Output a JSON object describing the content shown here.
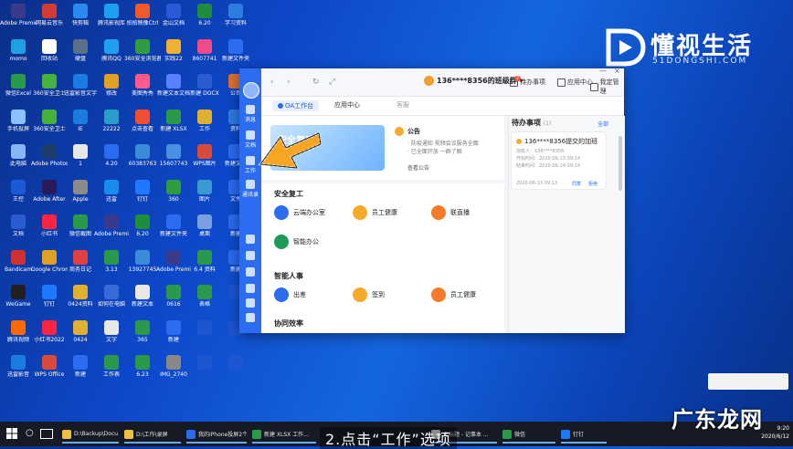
{
  "desktop": {
    "icons": [
      {
        "label": "Adobe Premie",
        "color": "#3a3a8c"
      },
      {
        "label": "网易云音乐",
        "color": "#d43c33"
      },
      {
        "label": "快剪辑",
        "color": "#2b8af0"
      },
      {
        "label": "腾讯影视库",
        "color": "#1aa0f0"
      },
      {
        "label": "拍拍映像Ctrl",
        "color": "#f05a28"
      },
      {
        "label": "金山文档",
        "color": "#2a5bd7"
      },
      {
        "label": "6.20",
        "color": "#1f8d3c"
      },
      {
        "label": "学习资料",
        "color": "#2d7de0"
      },
      {
        "label": "momo",
        "color": "#20a0e0"
      },
      {
        "label": "回收站",
        "color": "#ffffff"
      },
      {
        "label": "硬盘",
        "color": "#5b6f8a"
      },
      {
        "label": "腾讯QQ",
        "color": "#1ea0ef"
      },
      {
        "label": "360安全浏览器",
        "color": "#2e9c3f"
      },
      {
        "label": "实践22",
        "color": "#f0b030"
      },
      {
        "label": "8607741",
        "color": "#f04a8a"
      },
      {
        "label": "新建文件夹",
        "color": "#2b6cf0"
      },
      {
        "label": "微信Excel",
        "color": "#2a9a4a"
      },
      {
        "label": "360安全卫士",
        "color": "#47b33e"
      },
      {
        "label": "迅雷影音文字",
        "color": "#1a7ce0"
      },
      {
        "label": "修改",
        "color": "#e0a020"
      },
      {
        "label": "美图秀秀",
        "color": "#ff5a8a"
      },
      {
        "label": "新建文本文档",
        "color": "#5a7fff"
      },
      {
        "label": "新建 DOCX",
        "color": "#2b5bd0"
      },
      {
        "label": "公司",
        "color": "#e07030"
      },
      {
        "label": "手机投屏",
        "color": "#8ac0ff"
      },
      {
        "label": "360安全卫士",
        "color": "#47b33e"
      },
      {
        "label": "IE",
        "color": "#1a7ce0"
      },
      {
        "label": "22222",
        "color": "#2aa0c8"
      },
      {
        "label": "点击查看",
        "color": "#f05030"
      },
      {
        "label": "新建 XLSX",
        "color": "#2a9a4a"
      },
      {
        "label": "工作",
        "color": "#e0b030"
      },
      {
        "label": "资料",
        "color": "#2d7de0"
      },
      {
        "label": "此电脑",
        "color": "#8ab4f8"
      },
      {
        "label": "Adobe Photosh",
        "color": "#1c3d6a"
      },
      {
        "label": "1",
        "color": "#e8e8e8"
      },
      {
        "label": "4.20",
        "color": "#2b6cf0"
      },
      {
        "label": "60383763",
        "color": "#3a8bd8"
      },
      {
        "label": "15607743",
        "color": "#4a90e2"
      },
      {
        "label": "WPS图片",
        "color": "#d84a3a"
      },
      {
        "label": "新建文件",
        "color": "#2b6cf0"
      },
      {
        "label": "王控",
        "color": "#1a5ad6"
      },
      {
        "label": "Adobe After",
        "color": "#2a1a5a"
      },
      {
        "label": "Apple",
        "color": "#8a8a8a"
      },
      {
        "label": "迅雷",
        "color": "#1a8cf0"
      },
      {
        "label": "钉钉",
        "color": "#1f78ff"
      },
      {
        "label": "360",
        "color": "#2e9c3f"
      },
      {
        "label": "图片",
        "color": "#3a9ad0"
      },
      {
        "label": "文件",
        "color": "#2b6cf0"
      },
      {
        "label": "文档",
        "color": "#2b5bd0"
      },
      {
        "label": "小红书",
        "color": "#ff2442"
      },
      {
        "label": "微信截图",
        "color": "#2a9a4a"
      },
      {
        "label": "Adobe Premi",
        "color": "#3a3a8c"
      },
      {
        "label": "6.20",
        "color": "#1f8d3c"
      },
      {
        "label": "新建文件夹",
        "color": "#2b6cf0"
      },
      {
        "label": "桌面",
        "color": "#7aa0e0"
      },
      {
        "label": "新建",
        "color": "#2b6cf0"
      },
      {
        "label": "Bandicam",
        "color": "#d03030"
      },
      {
        "label": "Google Chrome",
        "color": "#e0a020"
      },
      {
        "label": "商务日记",
        "color": "#e04040"
      },
      {
        "label": "3.13",
        "color": "#2a9a4a"
      },
      {
        "label": "13927745",
        "color": "#3a8bd8"
      },
      {
        "label": "Adobe Premi",
        "color": "#3a3a8c"
      },
      {
        "label": "6.4 资料",
        "color": "#2a9a4a"
      },
      {
        "label": "新建",
        "color": "#2b6cf0"
      },
      {
        "label": "WeGame",
        "color": "#202020"
      },
      {
        "label": "钉钉",
        "color": "#1f78ff"
      },
      {
        "label": "0424资料",
        "color": "#e0b030"
      },
      {
        "label": "如何在电脑",
        "color": "#3a6ad8"
      },
      {
        "label": "新建文本",
        "color": "#e8e8e8"
      },
      {
        "label": "0616",
        "color": "#2a9a4a"
      },
      {
        "label": "表格",
        "color": "#2a9a4a"
      },
      {
        "label": "",
        "color": "#1e55d0"
      },
      {
        "label": "腾讯视频",
        "color": "#ff6a00"
      },
      {
        "label": "小红书2022",
        "color": "#ff2442"
      },
      {
        "label": "0424",
        "color": "#e0b030"
      },
      {
        "label": "文字",
        "color": "#e8e8e8"
      },
      {
        "label": "365",
        "color": "#2a9a4a"
      },
      {
        "label": "新建",
        "color": "#2b6cf0"
      },
      {
        "label": "",
        "color": "#1e55d0"
      },
      {
        "label": "",
        "color": "#1e55d0"
      },
      {
        "label": "迅雷影音",
        "color": "#1a7ce0"
      },
      {
        "label": "WPS Office",
        "color": "#d84a3a"
      },
      {
        "label": "新建",
        "color": "#2b6cf0"
      },
      {
        "label": "工作表",
        "color": "#2a9a4a"
      },
      {
        "label": "6.23",
        "color": "#2a9a4a"
      },
      {
        "label": "IMG_2740",
        "color": "#888888"
      },
      {
        "label": "",
        "color": "#1e55d0"
      },
      {
        "label": "",
        "color": "#1e55d0"
      }
    ]
  },
  "brand": {
    "name": "懂视生活",
    "domain": "51DONGSHI.COM"
  },
  "app": {
    "rail": [
      {
        "label": "消息",
        "icon": "message-icon"
      },
      {
        "label": "文档",
        "icon": "document-icon"
      },
      {
        "label": "工作",
        "icon": "grid-icon"
      },
      {
        "label": "通讯录",
        "icon": "contacts-icon"
      }
    ],
    "topbar": {
      "back": "‹",
      "forward": "›",
      "refresh": "↻",
      "expand": "⤢",
      "user": "136****8356的班级群 ▾",
      "todo_label": "待办事项",
      "todo_badge": "2",
      "app_center": "应用中心",
      "notes": "我定管理"
    },
    "tabs": [
      {
        "label": "OA工作台",
        "active": true
      },
      {
        "label": "应用中心",
        "active": false
      },
      {
        "label": "客服",
        "active": false
      }
    ],
    "banner_text": "安全复工",
    "announce": {
      "title": "公告",
      "lines": [
        "· 防疫通知  视频会议服务全面",
        "· 已全面开放  一群了解"
      ],
      "more": "查看公告"
    },
    "sections": [
      {
        "title": "安全复工",
        "apps": [
          {
            "label": "云端办公室",
            "color": "#2b6cf0"
          },
          {
            "label": "员工健康",
            "color": "#f7a928"
          },
          {
            "label": "联直播",
            "color": "#f77a28"
          },
          {
            "label": "智能办公",
            "color": "#1f9a5a"
          }
        ]
      },
      {
        "title": "智能人事",
        "apps": [
          {
            "label": "出差",
            "color": "#2b6cf0"
          },
          {
            "label": "签到",
            "color": "#f7a928"
          },
          {
            "label": "员工健康",
            "color": "#f77a28"
          }
        ]
      },
      {
        "title": "协同效率",
        "apps": []
      }
    ],
    "todo_panel": {
      "title": "待办事项",
      "count": "(1)",
      "all": "全部",
      "item": {
        "title": "136****8356提交的加班",
        "lines": [
          "加班人：136****8356",
          "开始时间：2020-06-13 09:14",
          "结束时间：2020-06-14 09:14",
          "2020-06-13 09:13"
        ],
        "agree": "同意",
        "reject": "拒绝"
      }
    }
  },
  "taskbar": {
    "items": [
      {
        "label": "D:\\Backup\\Docu...",
        "color": "#f0c040"
      },
      {
        "label": "D:\\工作\\录屏",
        "color": "#f0c040"
      },
      {
        "label": "我的iPhone投屏2个...",
        "color": "#2b6cf0"
      },
      {
        "label": "新建 XLSX 工作...",
        "color": "#2a9a4a"
      },
      {
        "label": "无标题 - 记事本 ...",
        "color": "#e8e8e8"
      },
      {
        "label": "微信",
        "color": "#2a9a4a"
      },
      {
        "label": "钉钉",
        "color": "#1f78ff"
      }
    ],
    "clock_time": "9:20",
    "clock_date": "2020/6/12"
  },
  "overlay": {
    "subtitle": "2.点击“工作”选项",
    "watermark": "广东龙网"
  }
}
